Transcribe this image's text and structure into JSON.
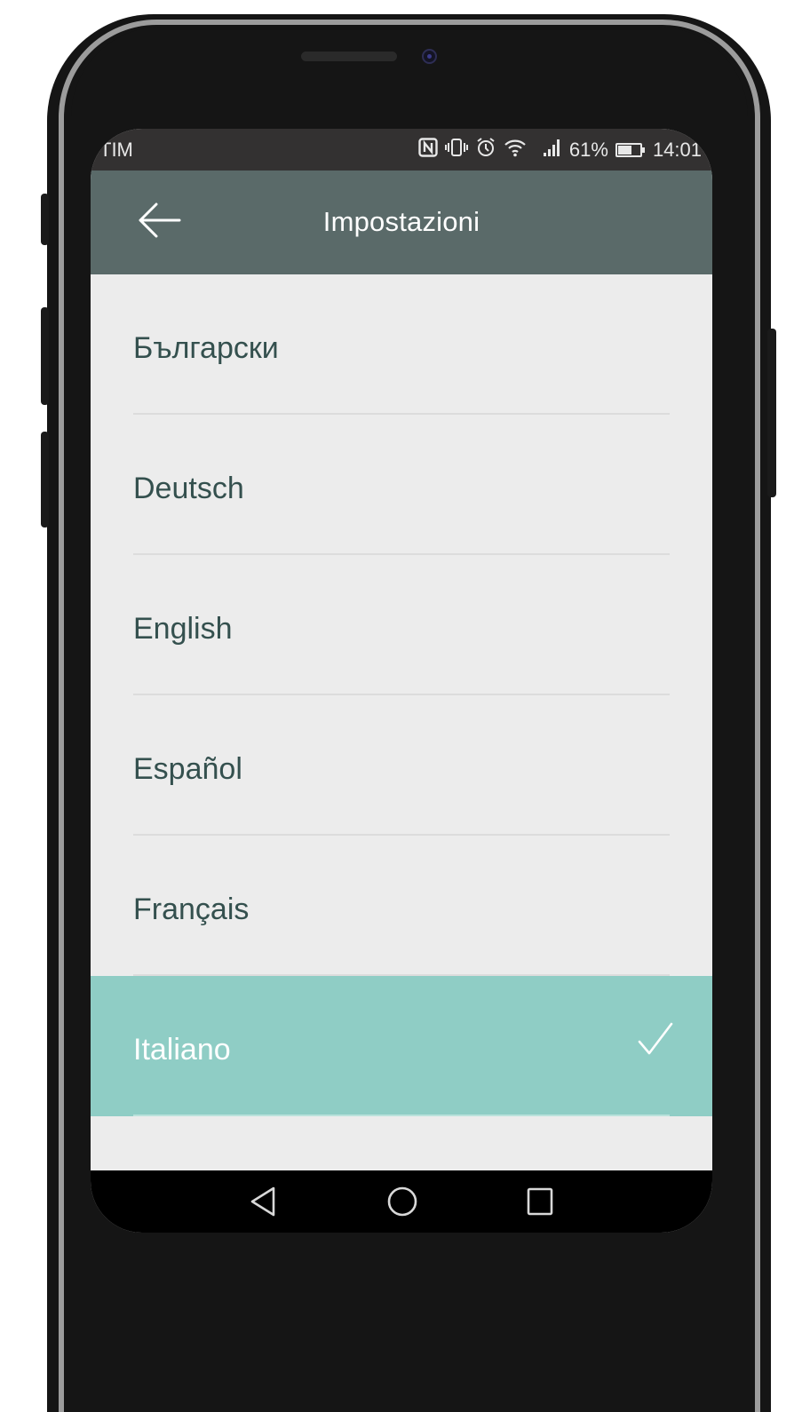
{
  "status_bar": {
    "carrier": "TIM",
    "battery_percent": "61%",
    "battery_level": 0.61,
    "time": "14:01",
    "icons": [
      "nfc-icon",
      "vibrate-icon",
      "alarm-icon",
      "wifi-icon",
      "signal-icon",
      "battery-icon"
    ]
  },
  "app_bar": {
    "title": "Impostazioni",
    "back_icon": "arrow-left-icon"
  },
  "languages": [
    {
      "label": "Български",
      "selected": false
    },
    {
      "label": "Deutsch",
      "selected": false
    },
    {
      "label": "English",
      "selected": false
    },
    {
      "label": "Español",
      "selected": false
    },
    {
      "label": "Français",
      "selected": false
    },
    {
      "label": "Italiano",
      "selected": true
    }
  ],
  "selected_icon": "checkmark-icon",
  "nav_bar": {
    "icons": [
      "back-triangle-icon",
      "home-circle-icon",
      "recents-square-icon"
    ]
  },
  "colors": {
    "app_bar": "#5a6a69",
    "selected_row": "#8fcdc5",
    "text": "#34504e",
    "list_background": "#ececec"
  }
}
